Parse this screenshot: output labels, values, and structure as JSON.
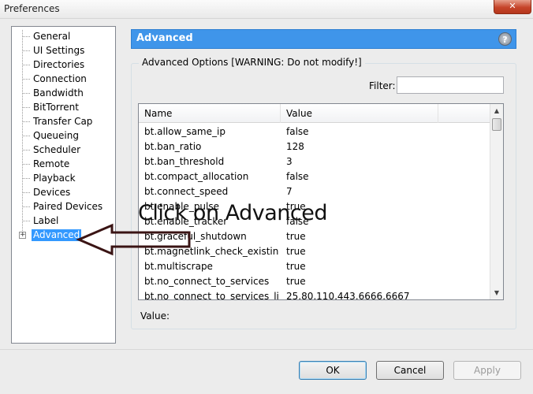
{
  "window": {
    "title": "Preferences",
    "close_glyph": "✕"
  },
  "sidebar": {
    "items": [
      {
        "label": "General"
      },
      {
        "label": "UI Settings"
      },
      {
        "label": "Directories"
      },
      {
        "label": "Connection"
      },
      {
        "label": "Bandwidth"
      },
      {
        "label": "BitTorrent"
      },
      {
        "label": "Transfer Cap"
      },
      {
        "label": "Queueing"
      },
      {
        "label": "Scheduler"
      },
      {
        "label": "Remote"
      },
      {
        "label": "Playback"
      },
      {
        "label": "Devices"
      },
      {
        "label": "Paired Devices"
      },
      {
        "label": "Label"
      },
      {
        "label": "Advanced",
        "selected": true,
        "expandable": true
      }
    ],
    "expander_glyph": "+"
  },
  "panel": {
    "header": "Advanced",
    "help_glyph": "?",
    "group_title": "Advanced Options [WARNING: Do not modify!]",
    "filter_label": "Filter:",
    "filter_value": "",
    "value_label": "Value:",
    "columns": [
      "Name",
      "Value"
    ],
    "rows": [
      {
        "name": "bt.allow_same_ip",
        "value": "false"
      },
      {
        "name": "bt.ban_ratio",
        "value": "128"
      },
      {
        "name": "bt.ban_threshold",
        "value": "3"
      },
      {
        "name": "bt.compact_allocation",
        "value": "false"
      },
      {
        "name": "bt.connect_speed",
        "value": "7"
      },
      {
        "name": "bt.enable_pulse",
        "value": "true"
      },
      {
        "name": "bt.enable_tracker",
        "value": "false"
      },
      {
        "name": "bt.graceful_shutdown",
        "value": "true"
      },
      {
        "name": "bt.magnetlink_check_existing_...",
        "value": "true"
      },
      {
        "name": "bt.multiscrape",
        "value": "true"
      },
      {
        "name": "bt.no_connect_to_services",
        "value": "true"
      },
      {
        "name": "bt.no_connect_to_services_list",
        "value": "25,80,110,443,6666,6667"
      }
    ],
    "scroll_up_glyph": "▲",
    "scroll_down_glyph": "▼"
  },
  "annotation": {
    "text": "Click on Advanced"
  },
  "buttons": {
    "ok": "OK",
    "cancel": "Cancel",
    "apply": "Apply"
  },
  "colors": {
    "header_blue": "#3f95ea",
    "selection": "#3399ff",
    "close_red": "#c6452a"
  }
}
